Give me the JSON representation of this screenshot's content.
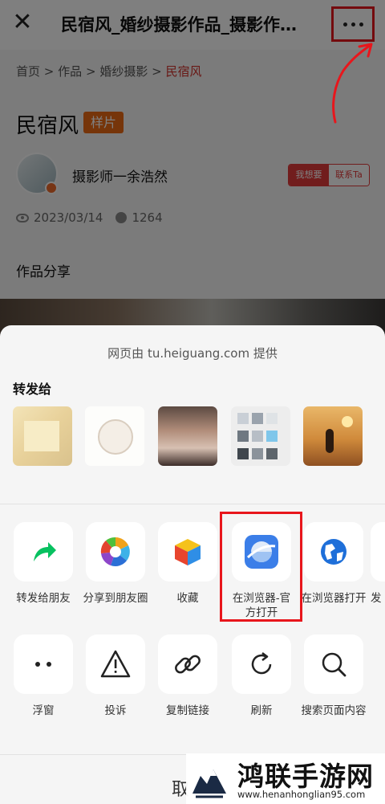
{
  "topbar": {
    "close_icon": "close-icon",
    "title": "民宿风_婚纱摄影作品_摄影作…",
    "more_icon": "more-dots-icon"
  },
  "breadcrumb": {
    "home": "首页",
    "works": "作品",
    "wedding": "婚纱摄影",
    "current": "民宿风",
    "sep": ">"
  },
  "work": {
    "title": "民宿风",
    "tag": "样片",
    "photographer": "摄影师一余浩然",
    "hire_label": "我想要",
    "contact_label": "联系Ta",
    "date": "2023/03/14",
    "views": "1264",
    "section": "作品分享"
  },
  "sheet": {
    "provider": "网页由 tu.heiguang.com 提供",
    "forward_to": "转发给",
    "contacts": [
      "contact-1",
      "contact-2",
      "contact-3",
      "contact-4",
      "contact-5"
    ],
    "actions_row1": [
      {
        "label": "转发给朋友",
        "icon": "forward-arrow-icon"
      },
      {
        "label": "分享到朋友圈",
        "icon": "moments-icon"
      },
      {
        "label": "收藏",
        "icon": "favorite-cube-icon"
      },
      {
        "label": "在浏览器-官方打开",
        "icon": "browser-official-icon"
      },
      {
        "label": "在浏览器打开",
        "icon": "browser-globe-icon"
      },
      {
        "label": "发",
        "icon": "send-icon"
      }
    ],
    "actions_row2": [
      {
        "label": "浮窗",
        "icon": "float-window-icon"
      },
      {
        "label": "投诉",
        "icon": "warning-icon"
      },
      {
        "label": "复制链接",
        "icon": "link-icon"
      },
      {
        "label": "刷新",
        "icon": "refresh-icon"
      },
      {
        "label": "搜索页面内容",
        "icon": "search-icon"
      }
    ],
    "cancel_partial": "取"
  },
  "watermark": {
    "text": "鸿联手游网",
    "url": "www.henanhonglian95.com"
  },
  "colors": {
    "highlight_red": "#e8161c",
    "tag_orange": "#ec6a15",
    "crumb_current": "#d2322d"
  }
}
